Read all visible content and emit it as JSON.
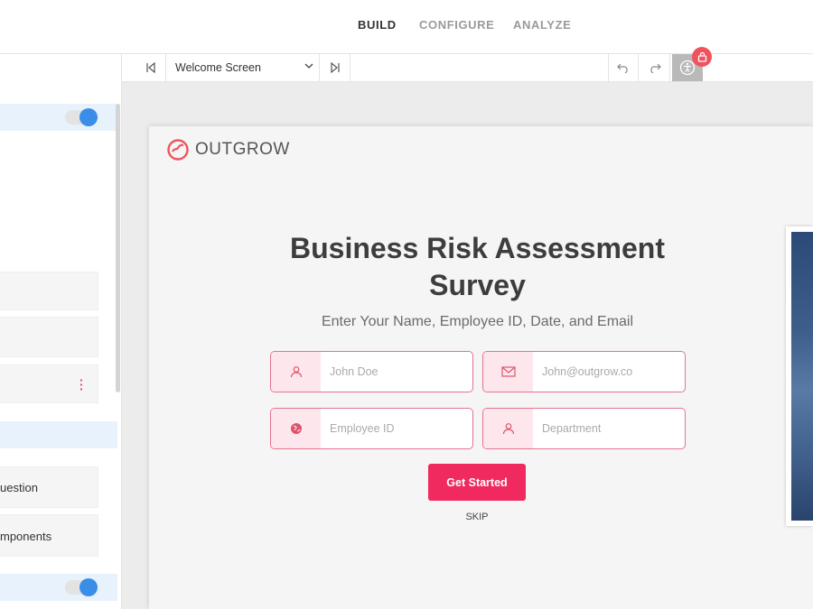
{
  "nav": {
    "tabs": [
      "BUILD",
      "CONFIGURE",
      "ANALYZE"
    ],
    "active": "BUILD"
  },
  "sidebar": {
    "items": [
      "uestion",
      "mponents"
    ]
  },
  "toolbar": {
    "screen_select": "Welcome Screen",
    "icons": [
      "first-screen-icon",
      "chevron-down-icon",
      "last-screen-icon",
      "undo-icon",
      "redo-icon",
      "accessibility-icon",
      "lock-icon"
    ]
  },
  "preview": {
    "logo": "OUTGROW",
    "title_line1": "Business Risk Assessment",
    "title_line2": "Survey",
    "subtitle": "Enter Your Name, Employee ID, Date, and Email",
    "fields": [
      {
        "icon": "user-icon",
        "placeholder": "John Doe"
      },
      {
        "icon": "envelope-icon",
        "placeholder": "John@outgrow.co"
      },
      {
        "icon": "globe-icon",
        "placeholder": "Employee ID"
      },
      {
        "icon": "user-icon",
        "placeholder": "Department"
      }
    ],
    "cta": "Get Started",
    "skip": "SKIP"
  },
  "colors": {
    "accent": "#f0295f",
    "field_border": "#e3738f",
    "field_icon_bg": "#fde7ec",
    "toggle_on": "#3b8ee8",
    "lock_badge": "#f0535e"
  }
}
